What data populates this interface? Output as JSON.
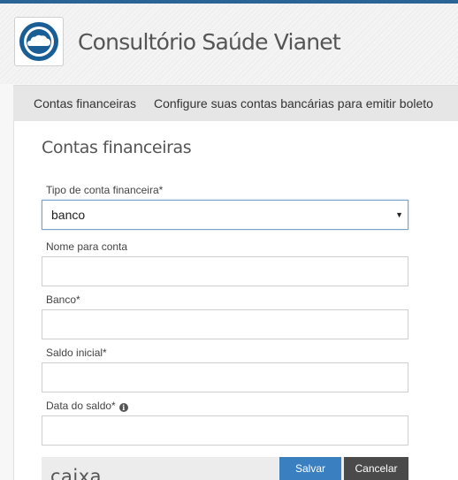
{
  "colors": {
    "accent": "#3a7fc0",
    "topbar": "#2a6496",
    "cancel": "#4a4a4a"
  },
  "header": {
    "logo_icon": "cloud-icon",
    "app_title": "Consultório Saúde Vianet"
  },
  "breadcrumb": {
    "item1": "Contas financeiras",
    "item2": "Configure suas contas bancárias para emitir boleto"
  },
  "main": {
    "section_title": "Contas financeiras",
    "fields": {
      "tipo": {
        "label": "Tipo de conta financeira*",
        "value": "banco"
      },
      "nome": {
        "label": "Nome para conta",
        "value": ""
      },
      "banco": {
        "label": "Banco*",
        "value": ""
      },
      "saldo": {
        "label": "Saldo inicial*",
        "value": ""
      },
      "data": {
        "label": "Data do saldo*",
        "info_icon": "info-icon",
        "value": ""
      }
    },
    "next_section_title": "caixa"
  },
  "actions": {
    "save_label": "Salvar",
    "cancel_label": "Cancelar"
  }
}
